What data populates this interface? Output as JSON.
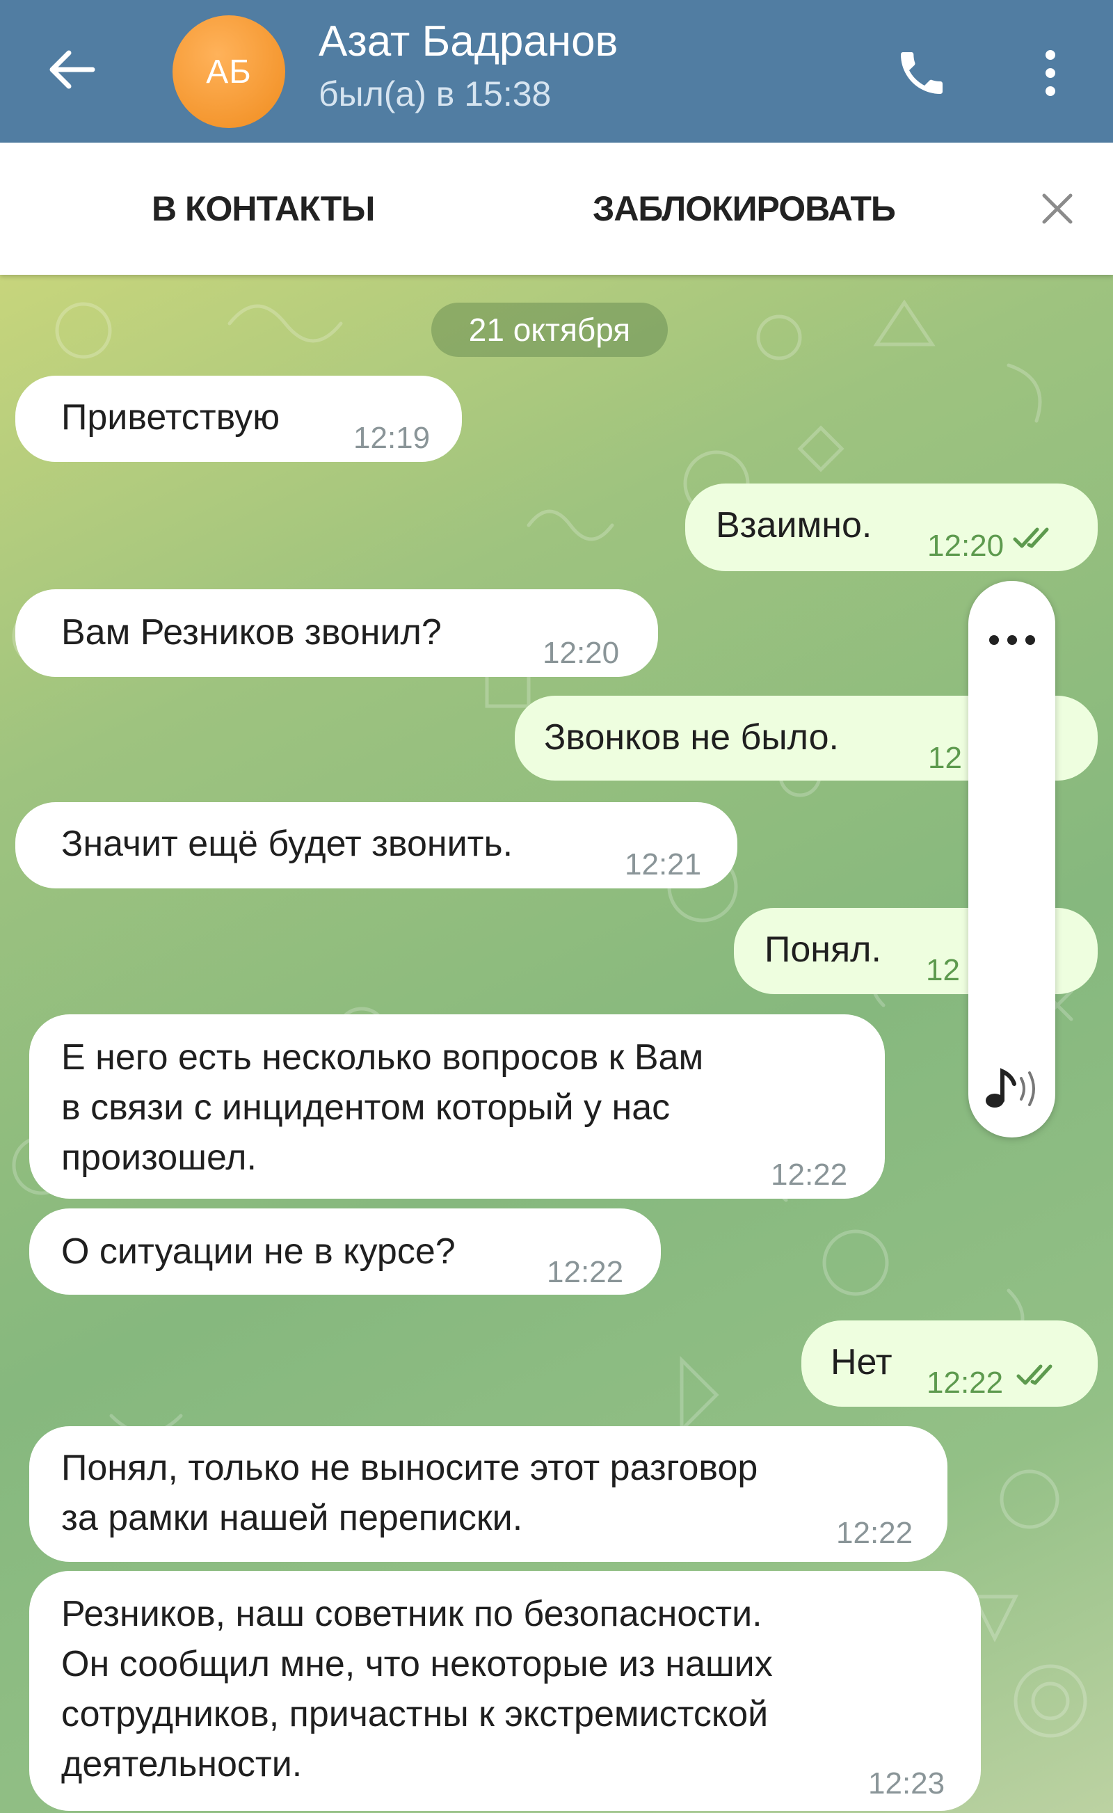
{
  "header": {
    "avatar_initials": "АБ",
    "title": "Азат Бадранов",
    "status": "был(а) в 15:38",
    "bg_color": "#517da2"
  },
  "action_bar": {
    "add_contact_label": "В КОНТАКТЫ",
    "block_label": "ЗАБЛОКИРОВАТЬ"
  },
  "icons": {
    "back": "arrow-left-icon",
    "call": "phone-icon",
    "menu": "vertical-dots-icon",
    "close": "close-icon",
    "more": "horizontal-dots-icon",
    "audio": "music-note-icon",
    "read": "double-check-icon"
  },
  "chat": {
    "date": "21 октября",
    "messages": [
      {
        "dir": "in",
        "text": "Приветствую",
        "time": "12:19"
      },
      {
        "dir": "out",
        "text": "Взаимно.",
        "time": "12:20"
      },
      {
        "dir": "in",
        "text": "Вам Резников звонил?",
        "time": "12:20"
      },
      {
        "dir": "out",
        "text": "Звонков не было.",
        "time": "12"
      },
      {
        "dir": "in",
        "text": "Значит ещё будет звонить.",
        "time": "12:21"
      },
      {
        "dir": "out",
        "text": "Понял.",
        "time": "12"
      },
      {
        "dir": "in",
        "text": "Е него есть несколько вопросов к Вам\nв связи с инцидентом который у нас\nпроизошел.",
        "time": "12:22"
      },
      {
        "dir": "in",
        "text": "О ситуации не в курсе?",
        "time": "12:22"
      },
      {
        "dir": "out",
        "text": "Нет",
        "time": "12:22"
      },
      {
        "dir": "in",
        "text": "Понял, только не выносите этот разговор\nза рамки нашей переписки.",
        "time": "12:22"
      },
      {
        "dir": "in",
        "text": "Резников, наш советник по безопасности.\nОн сообщил мне, что некоторые из наших\nсотрудников, причастны к экстремистской\nдеятельности.",
        "time": "12:23"
      }
    ]
  }
}
